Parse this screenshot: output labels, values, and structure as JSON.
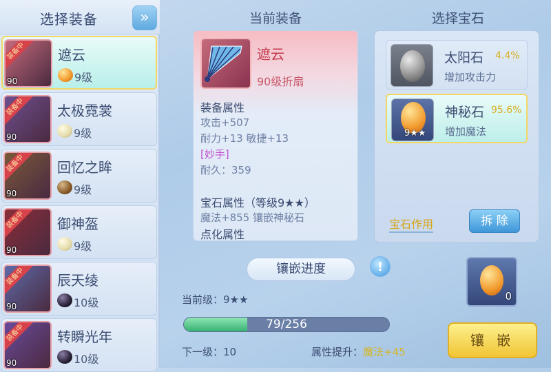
{
  "left": {
    "title": "选择装备",
    "items": [
      {
        "name": "遮云",
        "level": "90",
        "ribbon": "装备中",
        "gem_level": "9级",
        "gem": "orange",
        "selected": true
      },
      {
        "name": "太极霓裳",
        "level": "90",
        "ribbon": "装备中",
        "gem_level": "9级",
        "gem": "pale",
        "selected": false
      },
      {
        "name": "回忆之眸",
        "level": "90",
        "ribbon": "装备中",
        "gem_level": "9级",
        "gem": "brown",
        "selected": false
      },
      {
        "name": "御神盔",
        "level": "90",
        "ribbon": "装备中",
        "gem_level": "9级",
        "gem": "pale",
        "selected": false
      },
      {
        "name": "辰天绫",
        "level": "90",
        "ribbon": "装备中",
        "gem_level": "10级",
        "gem": "dark",
        "selected": false
      },
      {
        "name": "转瞬光年",
        "level": "90",
        "ribbon": "装备中",
        "gem_level": "10级",
        "gem": "dark",
        "selected": false
      }
    ]
  },
  "middle": {
    "title": "当前装备",
    "item_name": "遮云",
    "item_sub": "90级折扇",
    "equip_attr_heading": "装备属性",
    "attr1": "攻击+507",
    "attr2": "耐力+13 敏捷+13",
    "special": "[妙手]",
    "durability": "耐久：359",
    "gem_attr_heading": "宝石属性（等级9★★）",
    "gem_attr": "魔法+855 镶嵌神秘石",
    "refine_heading": "点化属性",
    "progress_label": "镶嵌进度",
    "info_icon": "!",
    "current_level": "当前级：9★★",
    "progress_text": "79/256",
    "progress_value": 79,
    "progress_max": 256,
    "next_level": "下一级：10",
    "attr_up_label": "属性提升：",
    "attr_up_value": "魔法+45"
  },
  "right": {
    "title": "选择宝石",
    "gems": [
      {
        "name": "太阳石",
        "pct": "4.4%",
        "desc": "增加攻击力",
        "selected": false,
        "stars": ""
      },
      {
        "name": "神秘石",
        "pct": "95.6%",
        "desc": "增加魔法",
        "selected": true,
        "stars": "9★★"
      }
    ],
    "effect_label": "宝石作用",
    "remove_label": "拆 除",
    "slot_count": "0",
    "inlay_label": "镶 嵌"
  }
}
